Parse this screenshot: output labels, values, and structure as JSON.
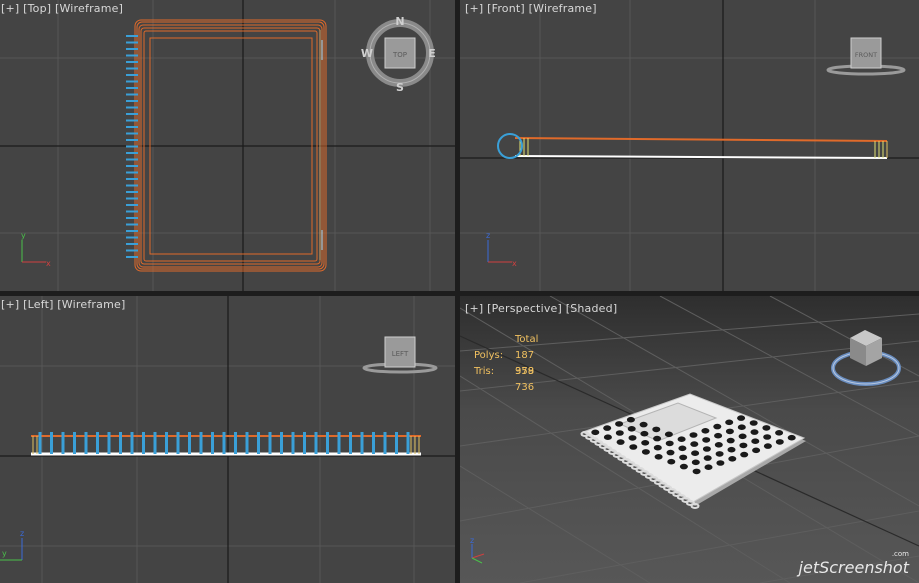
{
  "viewports": {
    "top": {
      "plus": "[+]",
      "name": "[Top]",
      "mode": "[Wireframe]"
    },
    "front": {
      "plus": "[+]",
      "name": "[Front]",
      "mode": "[Wireframe]"
    },
    "left": {
      "plus": "[+]",
      "name": "[Left]",
      "mode": "[Wireframe]"
    },
    "perspective": {
      "plus": "[+]",
      "name": "[Perspective]",
      "mode": "[Shaded]"
    }
  },
  "viewcube": {
    "top_face": "TOP",
    "front_face": "FRONT",
    "left_face": "LEFT",
    "compass": {
      "n": "N",
      "s": "S",
      "e": "E",
      "w": "W"
    }
  },
  "stats": {
    "header": "Total",
    "polys_label": "Polys:",
    "polys_value": "187 958",
    "tris_label": "Tris:",
    "tris_value": "379 736"
  },
  "axes": {
    "x": "x",
    "y": "y",
    "z": "z"
  },
  "watermark": {
    "brand": "jetScreenshot",
    "suffix": ".com"
  },
  "colors": {
    "viewport_bg": "#444444",
    "grid_line": "#555555",
    "grid_axis": "#1a1a1a",
    "object_orange": "#e06a2a",
    "spiral_blue": "#3aa0d8",
    "active_border": "#c8a030",
    "stats_text": "#f0c060"
  }
}
